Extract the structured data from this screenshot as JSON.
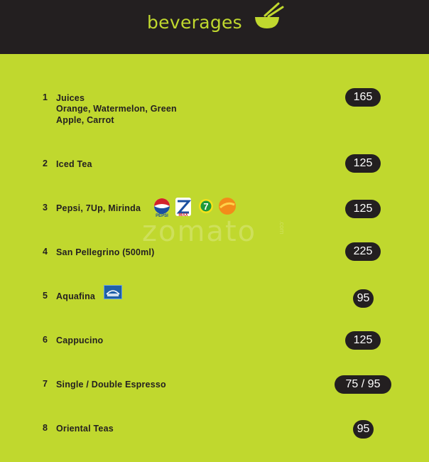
{
  "header": {
    "title": "beverages",
    "icon": "bowl-chopsticks-icon",
    "background": "#231f20",
    "accent": "#c0d82e"
  },
  "watermark": {
    "text": "zomato",
    "suffix": ".com"
  },
  "menu": {
    "items": [
      {
        "number": "1",
        "name": "Juices",
        "description": "Orange, Watermelon, Green Apple, Carrot",
        "price": "165"
      },
      {
        "number": "2",
        "name": "Iced Tea",
        "description": "",
        "price": "125"
      },
      {
        "number": "3",
        "name": "Pepsi, 7Up, Mirinda",
        "description": "",
        "price": "125",
        "logos": [
          "pepsi-logo",
          "diet-pepsi-logo",
          "7up-logo",
          "mirinda-logo"
        ]
      },
      {
        "number": "4",
        "name": "San Pellegrino (500ml)",
        "description": "",
        "price": "225"
      },
      {
        "number": "5",
        "name": "Aquafina",
        "description": "",
        "price": "95",
        "logos": [
          "aquafina-logo"
        ]
      },
      {
        "number": "6",
        "name": "Cappucino",
        "description": "",
        "price": "125"
      },
      {
        "number": "7",
        "name": "Single / Double Espresso",
        "description": "",
        "price": "75 / 95"
      },
      {
        "number": "8",
        "name": "Oriental Teas",
        "description": "",
        "price": "95"
      }
    ]
  }
}
